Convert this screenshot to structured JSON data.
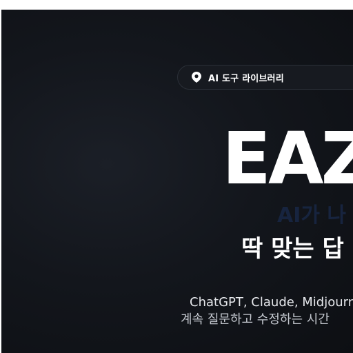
{
  "badge": {
    "icon": "location-pin-icon",
    "label": "AI 도구 라이브러리"
  },
  "hero": {
    "brand": "EAZ",
    "tagline": "AI가 나",
    "headline": "딱 맞는 답",
    "description_line1": "ChatGPT, Claude, Midjourn",
    "description_line2": "계속 질문하고 수정하는 시간"
  },
  "colors": {
    "background": "#12151b",
    "text": "#ffffff",
    "muted": "#c4c8cf",
    "ghost": "#17243f"
  }
}
